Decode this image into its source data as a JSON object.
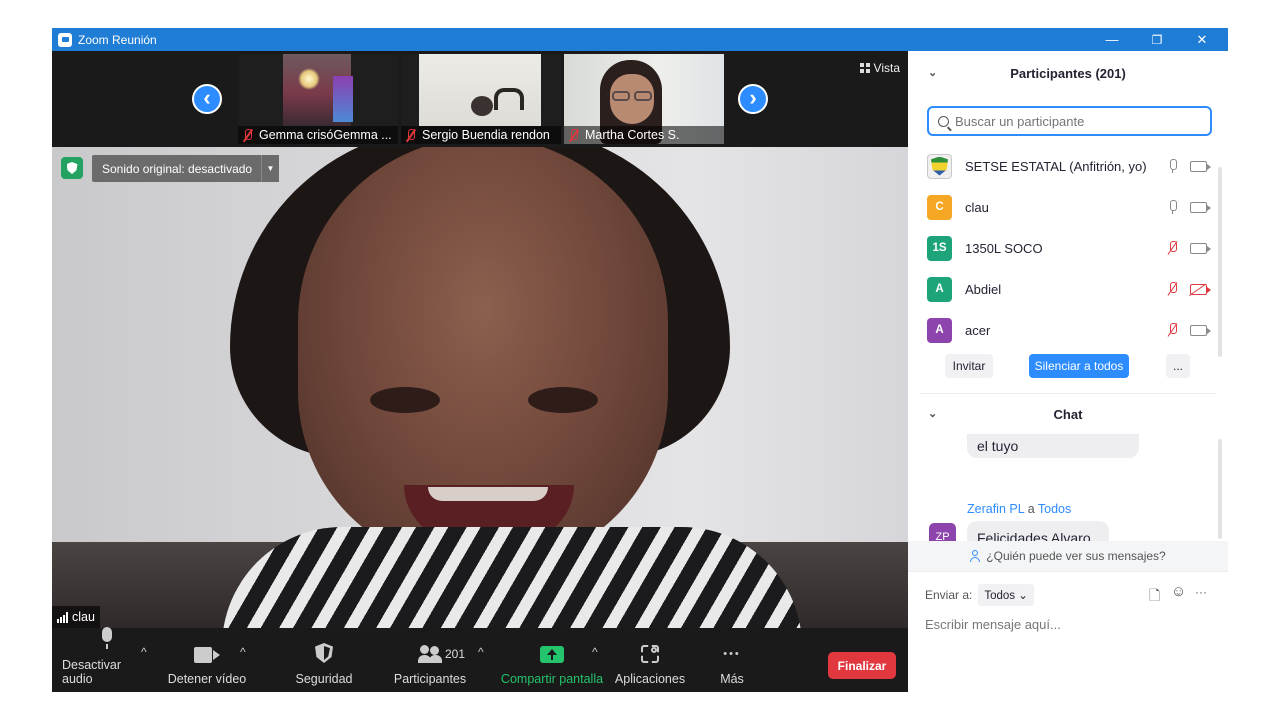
{
  "window": {
    "title": "Zoom Reunión",
    "minimize": "—",
    "restore": "❐",
    "close": "✕"
  },
  "strip": {
    "prev": "‹",
    "next": "›",
    "view_label": "Vista",
    "thumbs": [
      {
        "name": "Gemma crisóGemma ..."
      },
      {
        "name": "Sergio Buendia rendon"
      },
      {
        "name": "Martha Cortes S."
      }
    ]
  },
  "main_video": {
    "sound_label": "Sonido original: desactivado",
    "sound_dropdown": "▼",
    "speaker": "clau"
  },
  "toolbar": {
    "audio": "Desactivar audio",
    "video": "Detener vídeo",
    "security": "Seguridad",
    "participants": "Participantes",
    "participants_count": "201",
    "share": "Compartir pantalla",
    "apps": "Aplicaciones",
    "more": "Más",
    "more_dots": "•••",
    "end": "Finalizar",
    "caret": "^"
  },
  "participants_panel": {
    "title": "Participantes (201)",
    "chevron": "⌄",
    "search_placeholder": "Buscar un participante",
    "items": [
      {
        "initials": "",
        "name": "SETSE ESTATAL (Anfitrión, yo)",
        "color": "#f0f0f0",
        "mic": "on",
        "cam": "on"
      },
      {
        "initials": "C",
        "name": "clau",
        "color": "#f5a623",
        "mic": "on",
        "cam": "on"
      },
      {
        "initials": "1S",
        "name": "1350L SOCO",
        "color": "#1ea47a",
        "mic": "muted",
        "cam": "on"
      },
      {
        "initials": "A",
        "name": "Abdiel",
        "color": "#1ea47a",
        "mic": "muted",
        "cam": "off"
      },
      {
        "initials": "A",
        "name": "acer",
        "color": "#8e44ad",
        "mic": "muted",
        "cam": "on"
      }
    ],
    "invite": "Invitar",
    "mute_all": "Silenciar a todos",
    "more": "..."
  },
  "chat": {
    "title": "Chat",
    "chevron": "⌄",
    "prev_message": "el tuyo",
    "sender": "Zerafin PL",
    "to_word": "a",
    "recipient": "Todos",
    "sender_initials": "ZP",
    "sender_color": "#8e44ad",
    "message": "Felicidades Alvaro",
    "who_can_see": "¿Quién puede ver sus mensajes?",
    "send_to_label": "Enviar a:",
    "send_to_value": "Todos",
    "dropdown_icon": "⌄",
    "input_placeholder": "Escribir mensaje aquí...",
    "file_icon": "🗋",
    "emoji_icon": "☺",
    "more_icon": "···"
  }
}
